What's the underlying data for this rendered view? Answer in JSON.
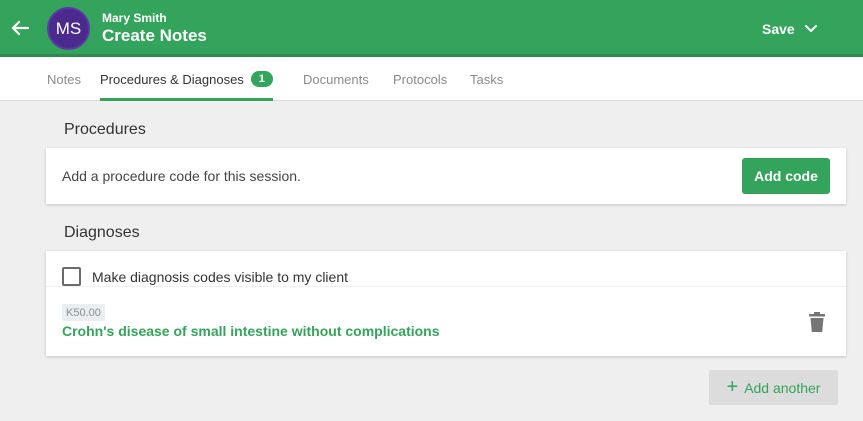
{
  "header": {
    "avatar_initials": "MS",
    "client_name": "Mary Smith",
    "title": "Create Notes",
    "save_label": "Save",
    "accent_color": "#34a35b",
    "avatar_color": "#4a2a8c"
  },
  "tabs": [
    {
      "label": "Notes",
      "active": false
    },
    {
      "label": "Procedures & Diagnoses",
      "active": true,
      "badge": "1"
    },
    {
      "label": "Documents",
      "active": false
    },
    {
      "label": "Protocols",
      "active": false
    },
    {
      "label": "Tasks",
      "active": false
    }
  ],
  "procedures": {
    "title": "Procedures",
    "empty_text": "Add a procedure code for this session.",
    "add_code_label": "Add code"
  },
  "diagnoses": {
    "title": "Diagnoses",
    "visible_to_client_label": "Make diagnosis codes visible to my client",
    "visible_to_client_checked": false,
    "items": [
      {
        "code": "K50.00",
        "description": "Crohn's disease of small intestine without complications"
      }
    ],
    "add_another_label": "Add another"
  },
  "icons": [
    "arrow-left-icon",
    "chevron-down-icon",
    "checkbox-icon",
    "trash-icon",
    "plus-icon"
  ]
}
